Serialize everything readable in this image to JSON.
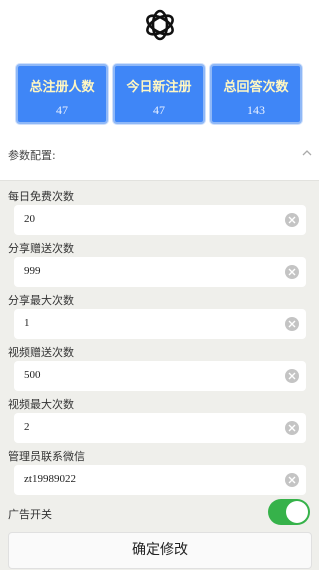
{
  "header": {
    "logo_icon": "openai-knot-icon"
  },
  "stats": [
    {
      "title": "总注册人数",
      "value": "47"
    },
    {
      "title": "今日新注册",
      "value": "47"
    },
    {
      "title": "总回答次数",
      "value": "143"
    }
  ],
  "config": {
    "title": "参数配置:",
    "collapse_icon": "chevron-up-icon",
    "fields": [
      {
        "label": "每日免费次数",
        "value": "20"
      },
      {
        "label": "分享赠送次数",
        "value": "999"
      },
      {
        "label": "分享最大次数",
        "value": "1"
      },
      {
        "label": "视频赠送次数",
        "value": "500"
      },
      {
        "label": "视频最大次数",
        "value": "2"
      },
      {
        "label": "管理员联系微信",
        "value": "zt19989022"
      }
    ],
    "ad_switch": {
      "label": "广告开关",
      "on": true,
      "color": "#36b24a"
    },
    "confirm_label": "确定修改"
  },
  "colors": {
    "stat_bg": "#3f86f7",
    "stat_title": "#fff7c2",
    "panel_bg": "#efefeb"
  }
}
